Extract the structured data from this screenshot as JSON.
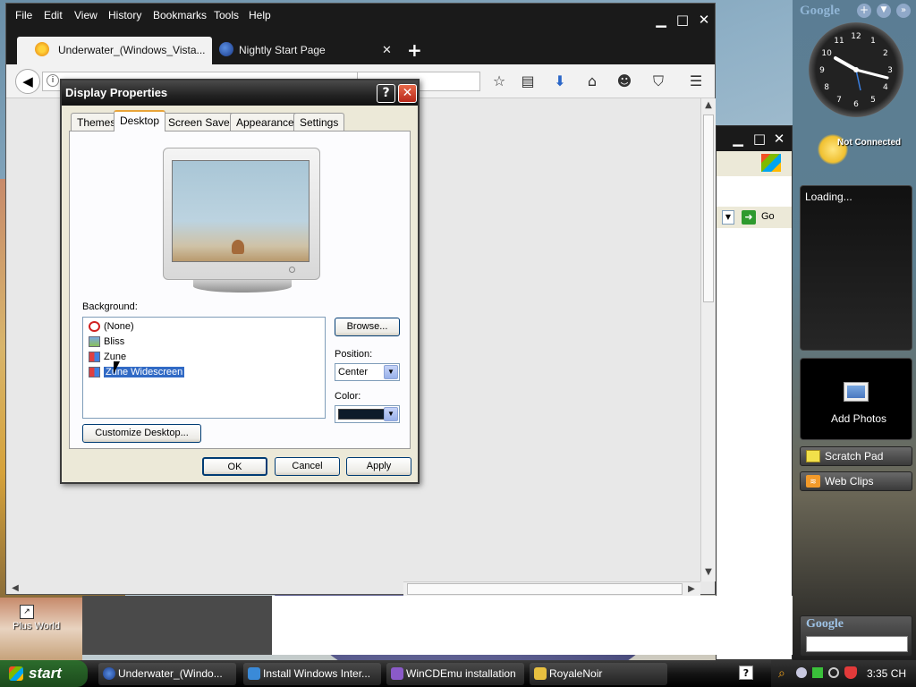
{
  "firefox": {
    "menu": [
      "File",
      "Edit",
      "View",
      "History",
      "Bookmarks",
      "Tools",
      "Help"
    ],
    "tabs": [
      {
        "label": "Underwater_(Windows_Vista..."
      },
      {
        "label": "Nightly Start Page"
      }
    ],
    "new_tab_icon": "plus-icon"
  },
  "dialog": {
    "title": "Display Properties",
    "tabs": [
      "Themes",
      "Desktop",
      "Screen Saver",
      "Appearance",
      "Settings"
    ],
    "background_label": "Background:",
    "backgrounds": [
      "(None)",
      "Bliss",
      "Zune",
      "Zune Widescreen"
    ],
    "selected_background": "Zune Widescreen",
    "browse": "Browse...",
    "position_label": "Position:",
    "position_value": "Center",
    "color_label": "Color:",
    "color_value": "#0d1b2a",
    "customize": "Customize Desktop...",
    "ok": "OK",
    "cancel": "Cancel",
    "apply": "Apply"
  },
  "ie_window": {
    "go": "Go"
  },
  "sidebar": {
    "google_top": "Google",
    "not_connected": "Not Connected",
    "loading": "Loading...",
    "add_photos": "Add Photos",
    "scratch_pad": "Scratch Pad",
    "web_clips": "Web Clips",
    "google_bottom": "Google",
    "clock_numbers": [
      "12",
      "1",
      "2",
      "3",
      "4",
      "5",
      "6",
      "7",
      "8",
      "9",
      "10",
      "11"
    ]
  },
  "desktop": {
    "icon_label": "Plus World"
  },
  "taskbar": {
    "start": "start",
    "tasks": [
      "Underwater_(Windo...",
      "Install Windows Inter...",
      "WinCDEmu installation",
      "RoyaleNoir"
    ],
    "time": "3:35 CH"
  }
}
